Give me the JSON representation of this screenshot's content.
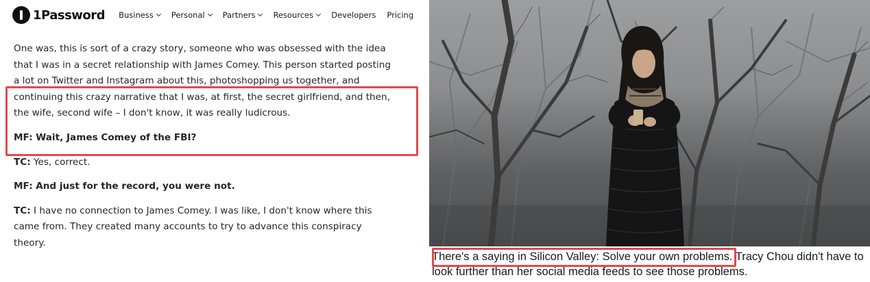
{
  "nav": {
    "logo_text": "1Password",
    "items": [
      {
        "label": "Business",
        "dropdown": true
      },
      {
        "label": "Personal",
        "dropdown": true
      },
      {
        "label": "Partners",
        "dropdown": true
      },
      {
        "label": "Resources",
        "dropdown": true
      },
      {
        "label": "Developers",
        "dropdown": false
      },
      {
        "label": "Pricing",
        "dropdown": false
      }
    ]
  },
  "article": {
    "para1_lines": [
      "One was, this is sort of a crazy story, someone who was obsessed with the idea",
      "that I was in a secret relationship with James Comey. This person started posting",
      "a lot on Twitter and Instagram about this, photoshopping us together, and",
      "continuing this crazy narrative that I was, at first, the secret girlfriend, and then,",
      "the wife, second wife – I don't know, it was really ludicrous."
    ],
    "q1": "MF: Wait, James Comey of the FBI?",
    "a1_speaker": "TC:",
    "a1_text": " Yes, correct.",
    "q2": "MF: And just for the record, you were not.",
    "a2_speaker": "TC:",
    "a2_lines": [
      " I have no connection to James Comey. I was like, I don't know where this",
      "came from. They created many accounts to try to advance this conspiracy",
      "theory."
    ]
  },
  "photo": {
    "colors": {
      "sky": "#9d9ea0",
      "tree": "#3c3b3a",
      "coat": "#151515",
      "scarf": "#8a7a66"
    }
  },
  "caption": {
    "line1": "There's a saying in Silicon Valley: Solve your own problems. Tracy Chou didn't have to",
    "line2": "look further than her social media feeds to see those problems."
  },
  "highlight_color": "#e5484d"
}
